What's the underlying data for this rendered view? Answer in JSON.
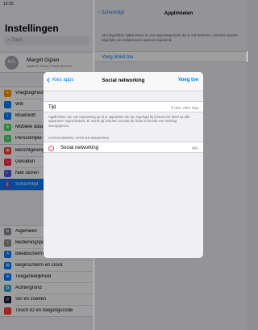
{
  "status": {
    "time": "10:00"
  },
  "sidebar": {
    "title": "Instellingen",
    "search_placeholder": "Zoek",
    "profile": {
      "initials": "MG",
      "name": "Margrit Gijzen",
      "subtitle": "Apple ID, iCloud, iTunes Store en..."
    },
    "group1": [
      {
        "label": "Vliegtuigmodus",
        "icon": "airplane-icon",
        "color": "#ff9500",
        "glyph": "✈"
      },
      {
        "label": "Wifi",
        "icon": "wifi-icon",
        "color": "#007aff",
        "glyph": "◠"
      },
      {
        "label": "Bluetooth",
        "icon": "bluetooth-icon",
        "color": "#007aff",
        "glyph": "ᛒ"
      },
      {
        "label": "Mobiele data",
        "icon": "antenna-icon",
        "color": "#4cd964",
        "glyph": "◉"
      },
      {
        "label": "Persoonlijke hotspot",
        "icon": "hotspot-icon",
        "color": "#4cd964",
        "glyph": "∞"
      }
    ],
    "group2": [
      {
        "label": "Berichtgeving",
        "icon": "notifications-icon",
        "color": "#ff3b30",
        "glyph": "▣"
      },
      {
        "label": "Geluiden",
        "icon": "sound-icon",
        "color": "#ff2d55",
        "glyph": "♪"
      },
      {
        "label": "Niet storen",
        "icon": "moon-icon",
        "color": "#5856d6",
        "glyph": "☾"
      },
      {
        "label": "Schermtijd",
        "icon": "hourglass-icon",
        "color": "#5856d6",
        "glyph": "⌛",
        "selected": true
      }
    ],
    "group3": [
      {
        "label": "Algemeen",
        "icon": "gear-icon",
        "color": "#8e8e93",
        "glyph": "⚙"
      },
      {
        "label": "Bedieningspaneel",
        "icon": "switches-icon",
        "color": "#8e8e93",
        "glyph": "≡"
      },
      {
        "label": "Beeldscherm en helderheid",
        "icon": "display-icon",
        "color": "#007aff",
        "glyph": "A"
      },
      {
        "label": "Beginscherm en Dock",
        "icon": "home-screen-icon",
        "color": "#007aff",
        "glyph": "▦"
      },
      {
        "label": "Toegankelijkheid",
        "icon": "accessibility-icon",
        "color": "#007aff",
        "glyph": "◍"
      },
      {
        "label": "Achtergrond",
        "icon": "wallpaper-icon",
        "color": "#34aadc",
        "glyph": "✿"
      },
      {
        "label": "Siri en zoeken",
        "icon": "siri-icon",
        "color": "#1c1c3a",
        "glyph": "◎"
      },
      {
        "label": "Touch ID en toegangscode",
        "icon": "fingerprint-icon",
        "color": "#ff3b30",
        "glyph": "◌"
      }
    ]
  },
  "detail": {
    "back_label": "Schermtijd",
    "title": "Applimieten",
    "description": "Stel dagelijkse tijdslimieten in voor appcategorieën die je wilt beheren. Limieten worden dagelijks om middernacht opnieuw ingesteld.",
    "add_limit_label": "Voeg limiet toe"
  },
  "modal": {
    "back_label": "Kies apps",
    "title": "Social networking",
    "add_label": "Voeg toe",
    "time_label": "Tijd",
    "time_value": "5 min, elke dag",
    "note": "Applimieten zijn van toepassing op al je apparaten die zijn ingelogd bij iCloud met 'Deel op alle apparaten' ingeschakeld. Er wordt vijf minuten voordat de limiet is bereikt een melding weergegeven.",
    "section_header": "CATEGORIEËN, APPS EN WEBSITES",
    "category": {
      "label": "Social networking",
      "value": "Alle",
      "icon": "social-networking-icon",
      "color": "#e8456f"
    }
  }
}
